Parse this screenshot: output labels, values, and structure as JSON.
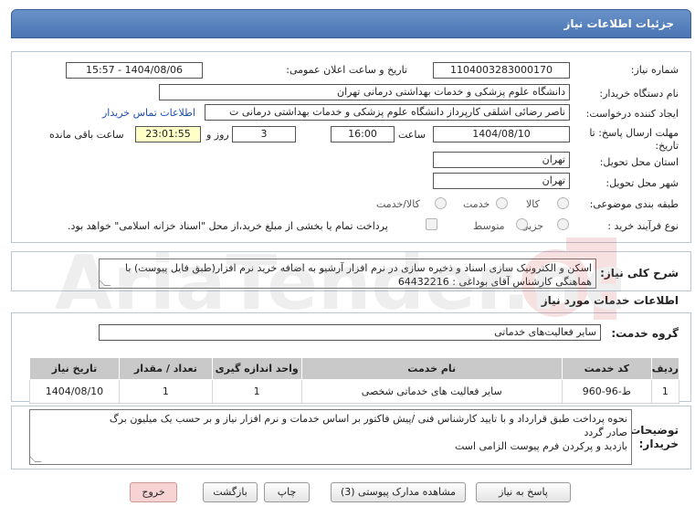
{
  "header": {
    "title": "جزئیات اطلاعات نیاز"
  },
  "fields": {
    "need_number_label": "شماره نیاز:",
    "need_number": "1104003283000170",
    "announce_label": "تاریخ و ساعت اعلان عمومی:",
    "announce_value": "1404/08/06 - 15:57",
    "buyer_org_label": "نام دستگاه خریدار:",
    "buyer_org": "دانشگاه علوم پزشکی و خدمات بهداشتی درمانی تهران",
    "creator_label": "ایجاد کننده درخواست:",
    "creator": "ناصر رضائی اشلقی کارپرداز دانشگاه علوم پزشکی و خدمات بهداشتی درمانی ت",
    "contact_link": "اطلاعات تماس خریدار",
    "deadline_label": "مهلت ارسال پاسخ: تا",
    "deadline_label2": "تاریخ:",
    "deadline_date": "1404/08/10",
    "time_label": "ساعت",
    "deadline_time": "16:00",
    "days_value": "3",
    "days_label": "روز و",
    "remaining_time": "23:01:55",
    "remaining_label": "ساعت باقی مانده",
    "province_label": "استان محل تحویل:",
    "province": "تهران",
    "city_label": "شهر محل تحویل:",
    "city": "تهران",
    "category_label": "طبقه بندی موضوعی:",
    "category_options": [
      "کالا",
      "خدمت",
      "کالا/خدمت"
    ],
    "process_label": "نوع فرآیند خرید :",
    "process_options": [
      "جزیی",
      "متوسط"
    ],
    "payment_note": "پرداخت تمام یا بخشی از مبلغ خرید،از محل \"اسناد خزانه اسلامی\" خواهد بود."
  },
  "description": {
    "label": "شرح کلی نیاز:",
    "text": "اسکن و الکترونیک سازی اسناد و ذخیره سازی در نرم افزار آرشیو به اضافه خرید نرم افزار(طبق فایل پیوست) با هماهنگی کارشناس آقای بوداغی : 64432216"
  },
  "services_section": {
    "heading": "اطلاعات خدمات مورد نیاز",
    "group_label": "گروه خدمت:",
    "group_value": "سایر فعالیت‌های خدماتی"
  },
  "table": {
    "headers": [
      "ردیف",
      "کد خدمت",
      "نام خدمت",
      "واحد اندازه گیری",
      "تعداد / مقدار",
      "تاریخ نیاز"
    ],
    "rows": [
      [
        "1",
        "ط-96-960",
        "سایر فعالیت های خدماتی شخصی",
        "1",
        "1",
        "1404/08/10"
      ]
    ]
  },
  "buyer_notes": {
    "label": "توضیحات خریدار:",
    "line1": "نحوه پرداخت طبق قرارداد و با تایید کارشناس فنی /پیش فاکتور بر اساس خدمات و نرم افزار نیاز و بر حسب یک میلیون برگ",
    "line2": "صادر گردد",
    "line3": "بازدید و پرکردن فرم پیوست الزامی است"
  },
  "buttons": {
    "reply": "پاسخ به نیاز",
    "attachments": "مشاهده مدارک پیوستی (3)",
    "print": "چاپ",
    "back": "بازگشت",
    "exit": "خروج"
  },
  "watermark": {
    "text": "AriaTender.net"
  },
  "colors": {
    "title_bar": "#5a84c0",
    "highlight_yellow": "#ffffc8",
    "link": "#1f4fb0",
    "exit_button": "#f7d3d3"
  }
}
